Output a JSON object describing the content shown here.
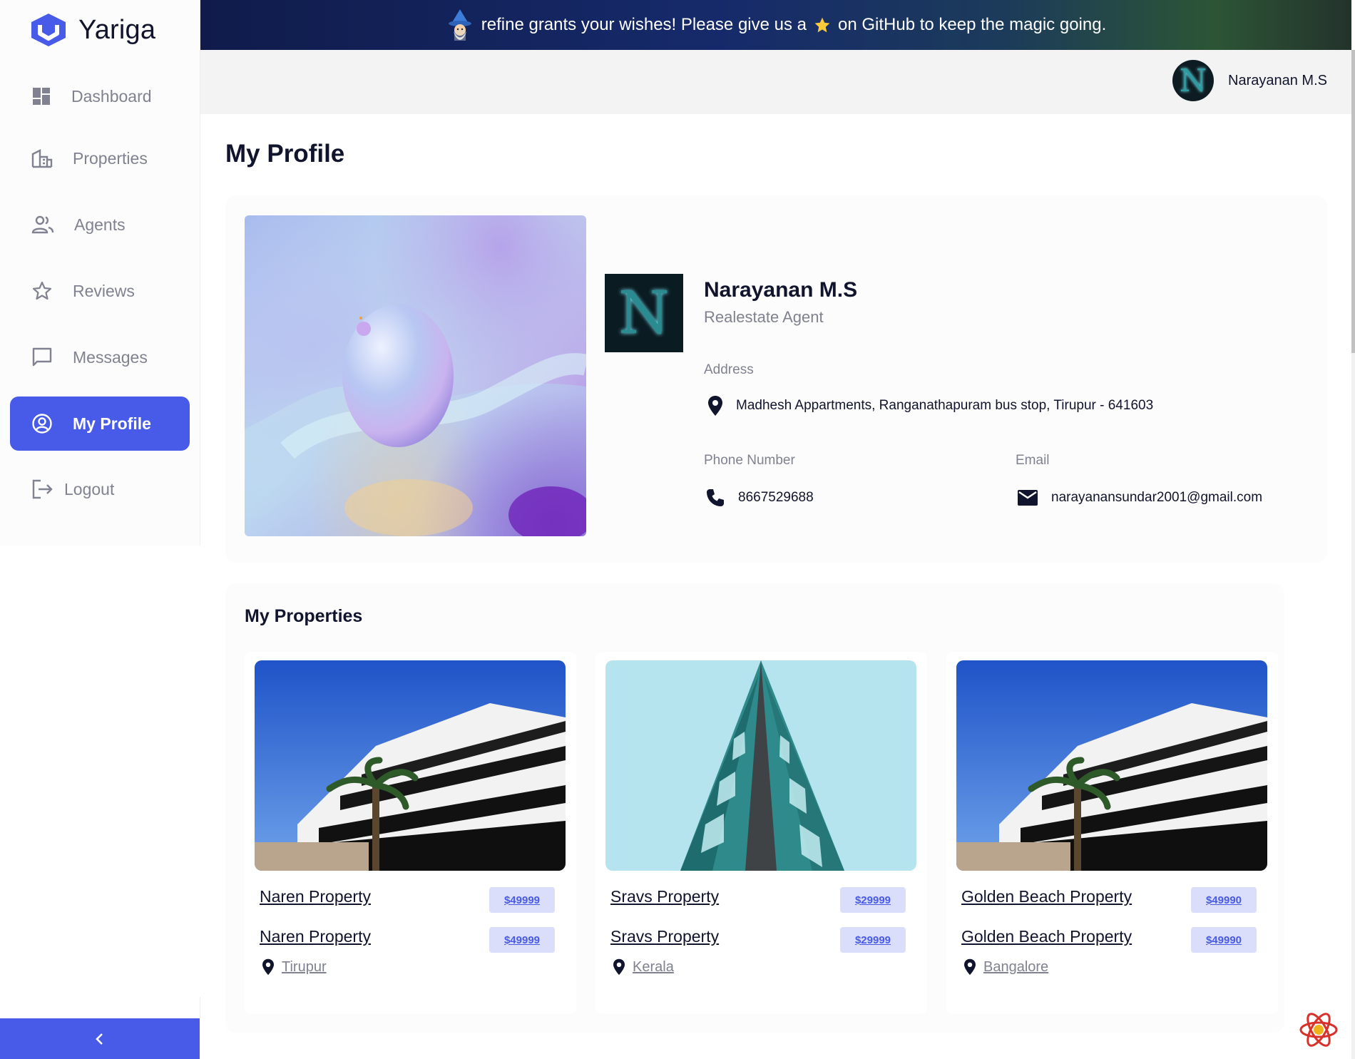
{
  "app": {
    "name": "Yariga",
    "accent": "#475BE8"
  },
  "banner": {
    "text_before": "refine grants your wishes! Please give us a",
    "text_after": "on GitHub to keep the magic going."
  },
  "sidebar": {
    "items": [
      {
        "label": "Dashboard",
        "icon": "dashboard-icon"
      },
      {
        "label": "Properties",
        "icon": "building-icon"
      },
      {
        "label": "Agents",
        "icon": "people-icon"
      },
      {
        "label": "Reviews",
        "icon": "star-icon"
      },
      {
        "label": "Messages",
        "icon": "chat-icon"
      },
      {
        "label": "My Profile",
        "icon": "account-icon",
        "active": true
      },
      {
        "label": "Logout",
        "icon": "logout-icon"
      }
    ]
  },
  "header": {
    "user_name": "Narayanan M.S",
    "avatar_letter": "N"
  },
  "page": {
    "title": "My Profile"
  },
  "profile": {
    "avatar_letter": "N",
    "name": "Narayanan M.S",
    "role": "Realestate Agent",
    "address_label": "Address",
    "address": "Madhesh Appartments, Ranganathapuram bus stop, Tirupur - 641603",
    "phone_label": "Phone Number",
    "phone": "8667529688",
    "email_label": "Email",
    "email": "narayanansundar2001@gmail.com"
  },
  "properties": {
    "title": "My Properties",
    "items": [
      {
        "title": "Naren Property",
        "price": "$49999",
        "location": "Tirupur",
        "image": "apartment-photo"
      },
      {
        "title": "Sravs Property",
        "price": "$29999",
        "location": "Kerala",
        "image": "tower-photo"
      },
      {
        "title": "Golden Beach Property",
        "price": "$49990",
        "location": "Bangalore",
        "image": "apartment-photo"
      }
    ]
  }
}
